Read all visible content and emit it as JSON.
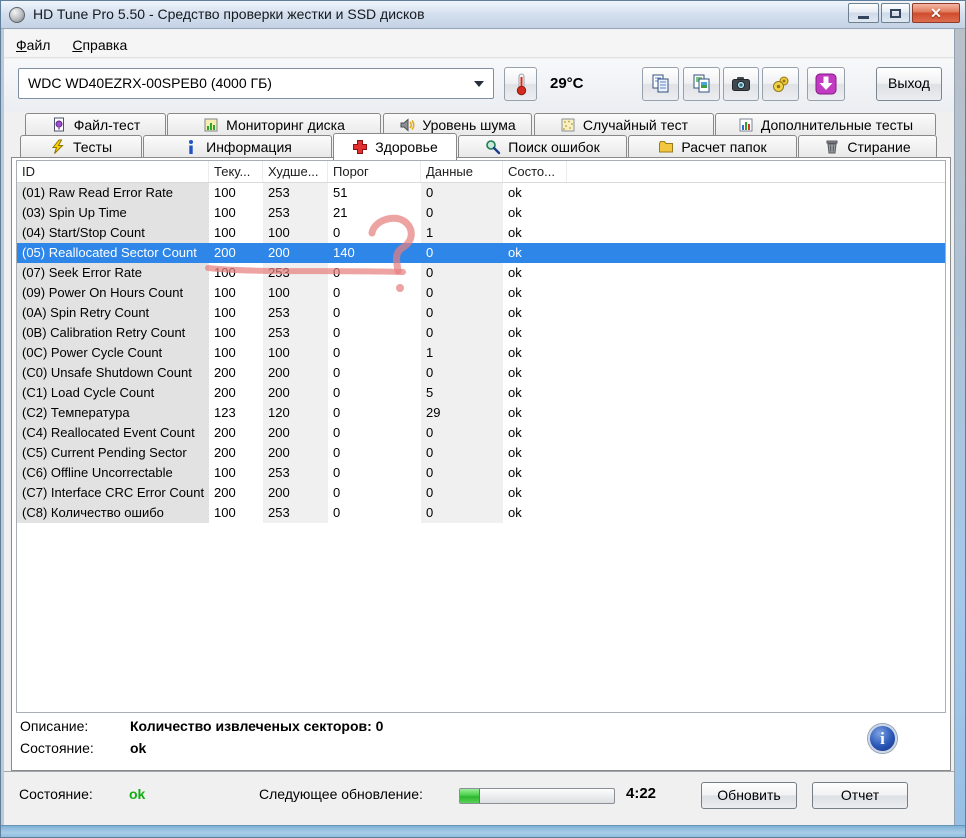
{
  "window": {
    "title": "HD Tune Pro 5.50 - Средство проверки жестки и SSD дисков"
  },
  "menu": {
    "items": [
      {
        "label": "Файл"
      },
      {
        "label": "Справка"
      }
    ]
  },
  "toolbar": {
    "drive_select": "WDC WD40EZRX-00SPEB0 (4000 ГБ)",
    "temperature": "29°C",
    "exit_label": "Выход",
    "buttons": [
      {
        "icon": "copy-text-icon"
      },
      {
        "icon": "copy-image-icon"
      },
      {
        "icon": "screenshot-icon"
      },
      {
        "icon": "options-icon"
      },
      {
        "icon": "download-icon"
      }
    ]
  },
  "tabs": {
    "row1": [
      {
        "label": "Файл-тест",
        "icon": "file-test-icon"
      },
      {
        "label": "Мониторинг диска",
        "icon": "disk-monitor-icon"
      },
      {
        "label": "Уровень шума",
        "icon": "noise-level-icon"
      },
      {
        "label": "Случайный тест",
        "icon": "random-test-icon"
      },
      {
        "label": "Дополнительные тесты",
        "icon": "extra-tests-icon"
      }
    ],
    "row2": [
      {
        "label": "Тесты",
        "icon": "tests-icon"
      },
      {
        "label": "Информация",
        "icon": "information-icon"
      },
      {
        "label": "Здоровье",
        "icon": "health-icon",
        "active": true
      },
      {
        "label": "Поиск ошибок",
        "icon": "error-scan-icon"
      },
      {
        "label": "Расчет папок",
        "icon": "folder-usage-icon"
      },
      {
        "label": "Стирание",
        "icon": "erase-icon"
      }
    ]
  },
  "smart_table": {
    "columns": [
      "ID",
      "Теку...",
      "Худше...",
      "Порог",
      "Данные",
      "Состо..."
    ],
    "selected_index": 3,
    "rows": [
      {
        "id": "(01) Raw Read Error Rate",
        "current": "100",
        "worst": "253",
        "threshold": "51",
        "data": "0",
        "status": "ok"
      },
      {
        "id": "(03) Spin Up Time",
        "current": "100",
        "worst": "253",
        "threshold": "21",
        "data": "0",
        "status": "ok"
      },
      {
        "id": "(04) Start/Stop Count",
        "current": "100",
        "worst": "100",
        "threshold": "0",
        "data": "1",
        "status": "ok"
      },
      {
        "id": "(05) Reallocated Sector Count",
        "current": "200",
        "worst": "200",
        "threshold": "140",
        "data": "0",
        "status": "ok"
      },
      {
        "id": "(07) Seek Error Rate",
        "current": "100",
        "worst": "253",
        "threshold": "0",
        "data": "0",
        "status": "ok"
      },
      {
        "id": "(09) Power On Hours Count",
        "current": "100",
        "worst": "100",
        "threshold": "0",
        "data": "0",
        "status": "ok"
      },
      {
        "id": "(0A) Spin Retry Count",
        "current": "100",
        "worst": "253",
        "threshold": "0",
        "data": "0",
        "status": "ok"
      },
      {
        "id": "(0B) Calibration Retry Count",
        "current": "100",
        "worst": "253",
        "threshold": "0",
        "data": "0",
        "status": "ok"
      },
      {
        "id": "(0C) Power Cycle Count",
        "current": "100",
        "worst": "100",
        "threshold": "0",
        "data": "1",
        "status": "ok"
      },
      {
        "id": "(C0) Unsafe Shutdown Count",
        "current": "200",
        "worst": "200",
        "threshold": "0",
        "data": "0",
        "status": "ok"
      },
      {
        "id": "(C1) Load Cycle Count",
        "current": "200",
        "worst": "200",
        "threshold": "0",
        "data": "5",
        "status": "ok"
      },
      {
        "id": "(C2) Температура",
        "current": "123",
        "worst": "120",
        "threshold": "0",
        "data": "29",
        "status": "ok"
      },
      {
        "id": "(C4) Reallocated Event Count",
        "current": "200",
        "worst": "200",
        "threshold": "0",
        "data": "0",
        "status": "ok"
      },
      {
        "id": "(C5) Current Pending Sector",
        "current": "200",
        "worst": "200",
        "threshold": "0",
        "data": "0",
        "status": "ok"
      },
      {
        "id": "(C6) Offline Uncorrectable",
        "current": "100",
        "worst": "253",
        "threshold": "0",
        "data": "0",
        "status": "ok"
      },
      {
        "id": "(C7) Interface CRC Error Count",
        "current": "200",
        "worst": "200",
        "threshold": "0",
        "data": "0",
        "status": "ok"
      },
      {
        "id": "(C8) Количество ошибо",
        "current": "100",
        "worst": "253",
        "threshold": "0",
        "data": "0",
        "status": "ok"
      }
    ]
  },
  "description_panel": {
    "description_label": "Описание:",
    "description_value": "Количество извлеченых секторов: 0",
    "status_label": "Состояние:",
    "status_value": "ok",
    "info_glyph": "i"
  },
  "status_bar": {
    "status_label": "Состояние:",
    "status_value": "ok",
    "next_update_label": "Следующее обновление:",
    "progress_percent": 13,
    "countdown": "4:22",
    "refresh_label": "Обновить",
    "report_label": "Отчет"
  },
  "annotation": {
    "type": "hand-drawn question mark over selected row",
    "color": "#e87f7f"
  },
  "colors": {
    "selection_blue": "#2e86e8",
    "status_ok_green": "#12ad12",
    "download_purple": "#b62cb6",
    "health_cross_red": "#d92f2f"
  }
}
